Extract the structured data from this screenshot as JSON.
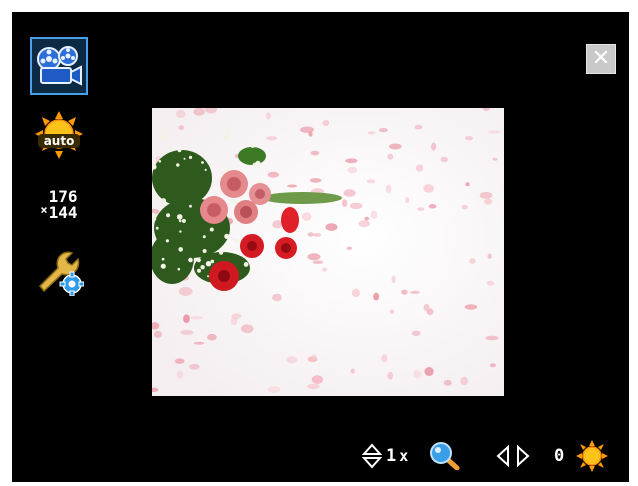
{
  "toolbar": {
    "video_mode": {
      "icon": "video-camera-icon",
      "selected": true
    },
    "white_balance": {
      "icon": "sun-auto-icon",
      "label": "auto"
    },
    "resolution": {
      "icon": "resolution-icon",
      "prefix": "×",
      "width": "176",
      "height": "144"
    },
    "settings": {
      "icon": "wrench-gear-icon"
    }
  },
  "close": {
    "icon": "close-icon",
    "glyph": "✕"
  },
  "preview": {
    "subject": "roses-and-petals-image"
  },
  "status": {
    "zoom_icon": "up-down-arrows-icon",
    "zoom_value": "1",
    "zoom_unit": "x",
    "magnifier_icon": "magnifier-icon",
    "prev_icon": "left-arrow-icon",
    "next_icon": "right-arrow-icon",
    "brightness_value": "0",
    "brightness_icon": "sun-icon"
  },
  "colors": {
    "background": "#000000",
    "selection_border": "#4aa0e6",
    "close_bg": "#c9c9c9"
  }
}
